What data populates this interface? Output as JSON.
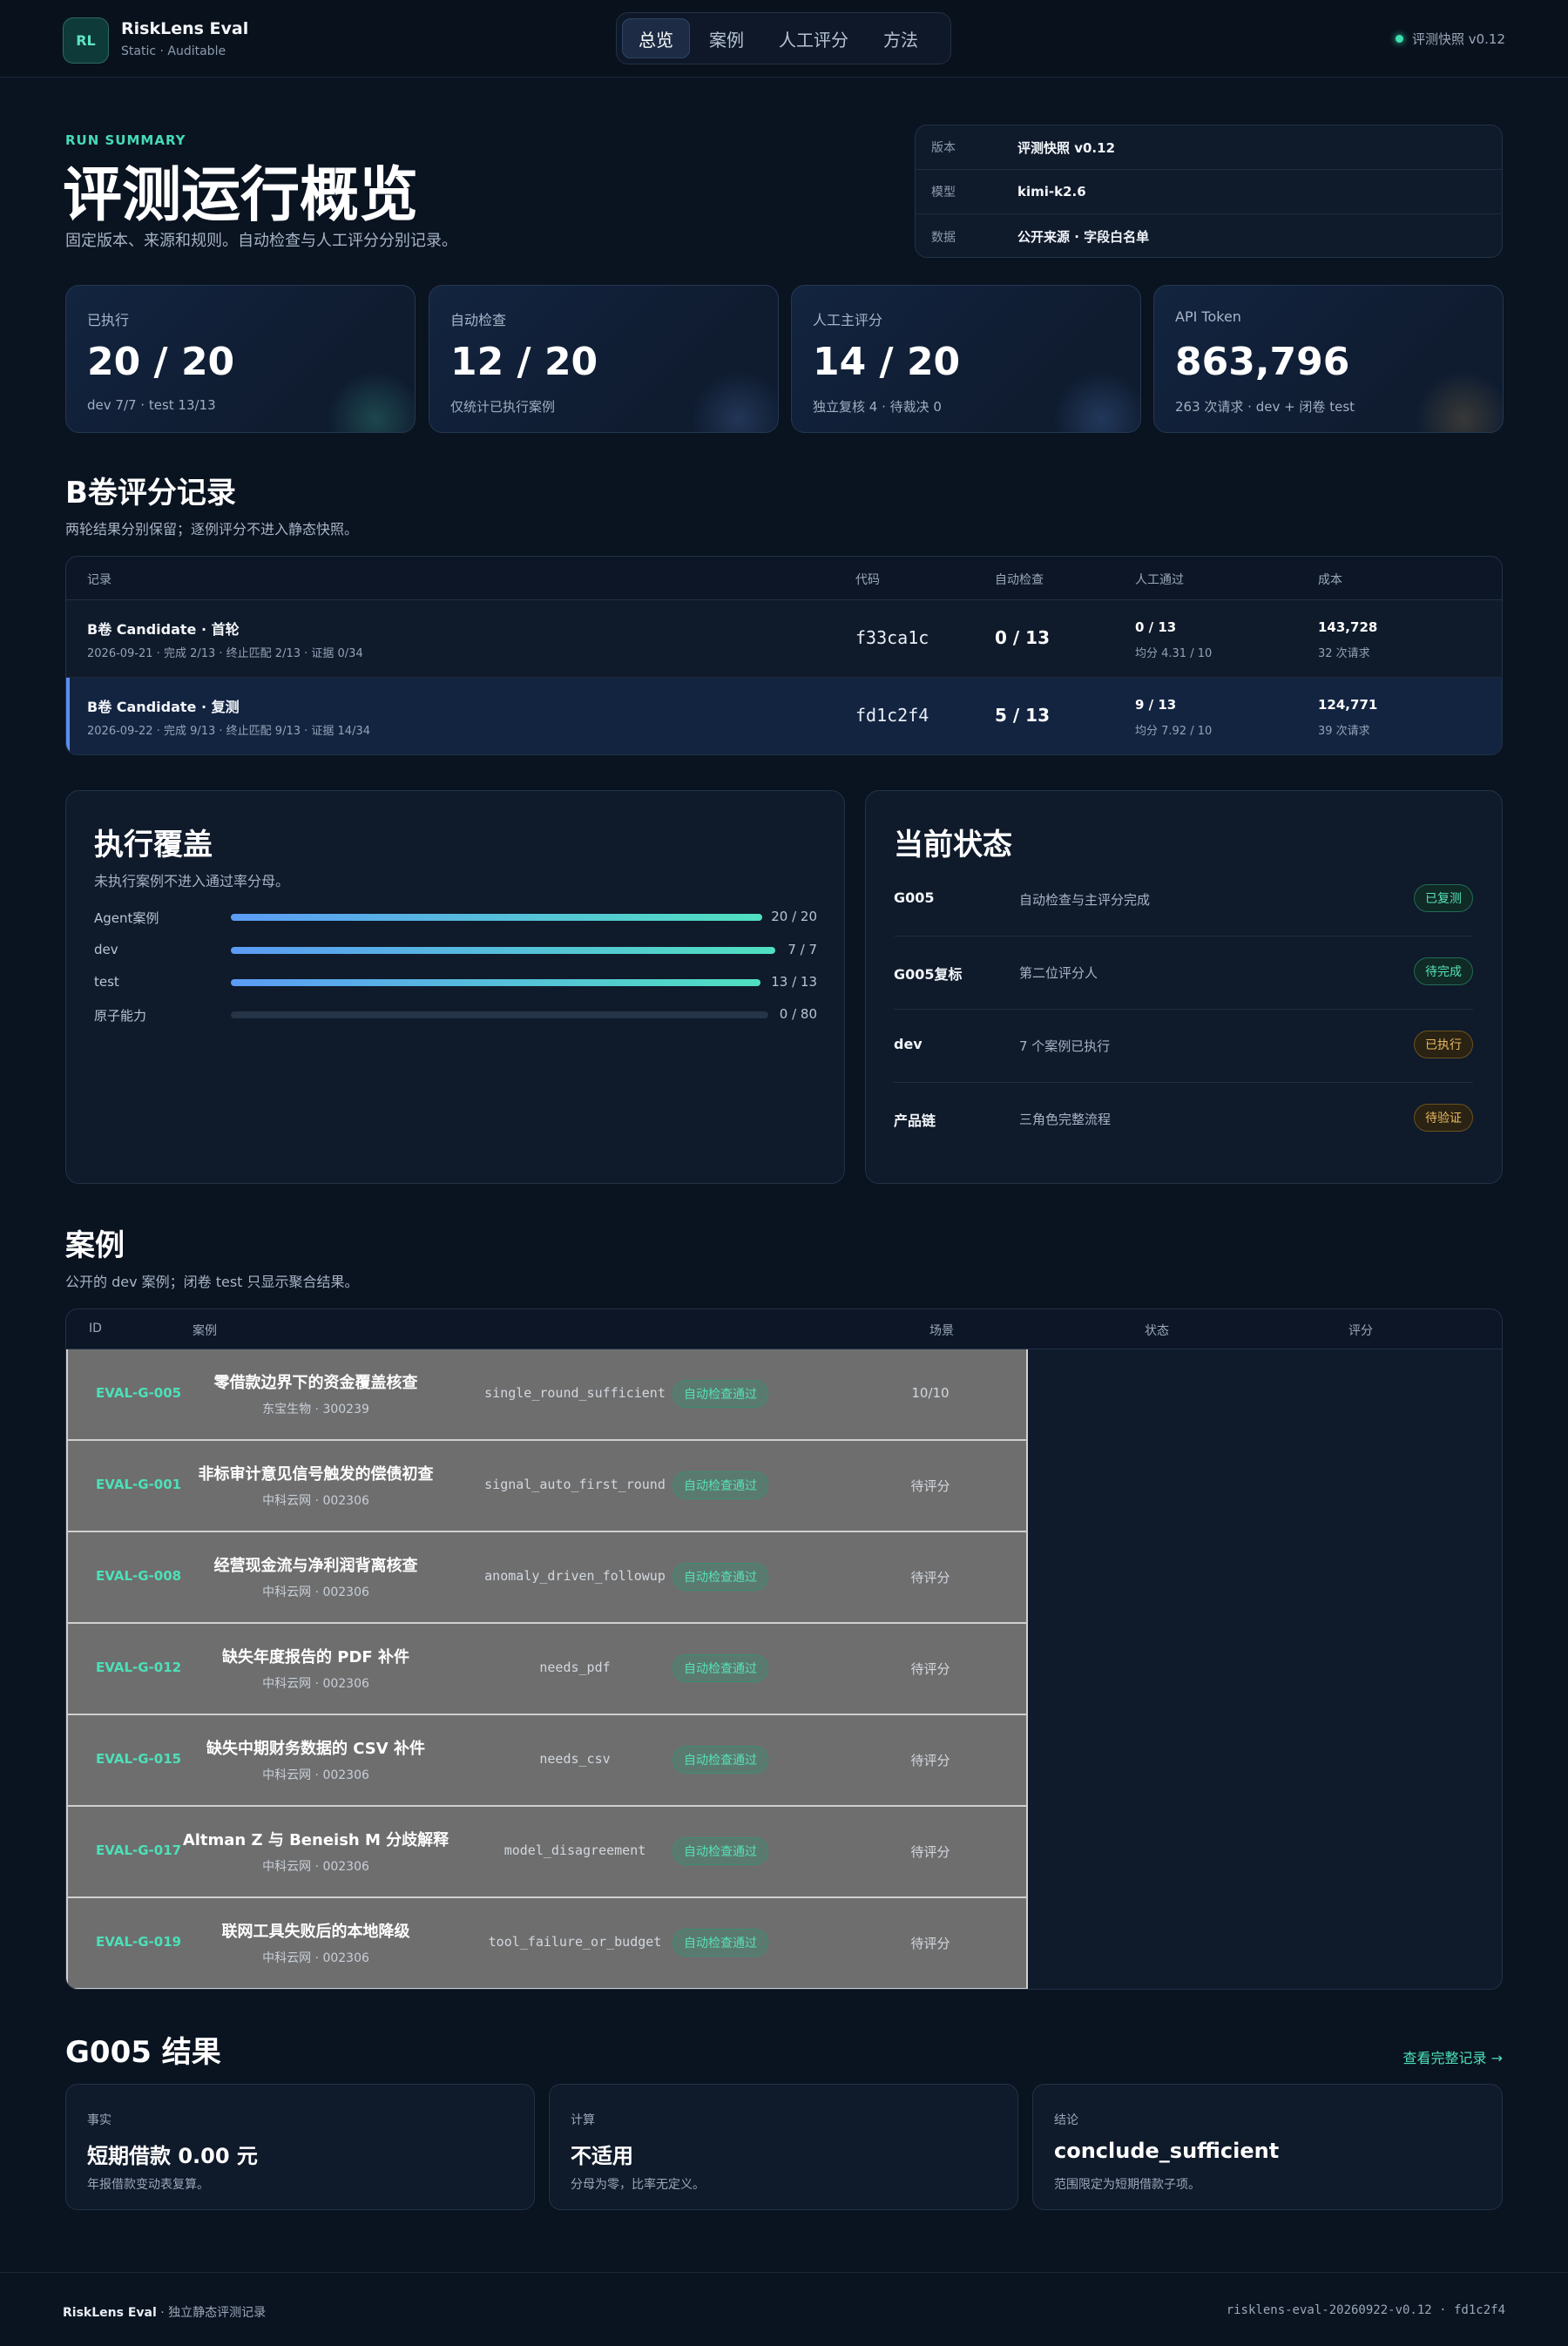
{
  "header": {
    "logo": "RL",
    "brand": "RiskLens Eval",
    "tagline": "Static · Auditable",
    "nav": [
      "总览",
      "案例",
      "人工评分",
      "方法"
    ],
    "snapshot": "评测快照 v0.12"
  },
  "hero": {
    "eyebrow": "RUN SUMMARY",
    "title": "评测运行概览",
    "subtitle": "固定版本、来源和规则。自动检查与人工评分分别记录。",
    "meta": [
      {
        "k": "版本",
        "v": "评测快照 v0.12"
      },
      {
        "k": "模型",
        "v": "kimi-k2.6"
      },
      {
        "k": "数据",
        "v": "公开来源 · 字段白名单"
      }
    ]
  },
  "stats": [
    {
      "label": "已执行",
      "value": "20 / 20",
      "note": "dev 7/7 · test 13/13"
    },
    {
      "label": "自动检查",
      "value": "12 / 20",
      "note": "仅统计已执行案例"
    },
    {
      "label": "人工主评分",
      "value": "14 / 20",
      "note": "独立复核 4 · 待裁决 0"
    },
    {
      "label": "API Token",
      "value": "863,796",
      "note": "263 次请求 · dev + 闭卷 test"
    }
  ],
  "b_section": {
    "title": "B卷评分记录",
    "subtitle": "两轮结果分别保留；逐例评分不进入静态快照。",
    "columns": [
      "记录",
      "代码",
      "自动检查",
      "人工通过",
      "成本"
    ],
    "rows": [
      {
        "title": "B卷 Candidate · 首轮",
        "meta": "2026-09-21 · 完成 2/13 · 终止匹配 2/13 · 证据 0/34",
        "code": "f33ca1c",
        "auto": "0 / 13",
        "manual": "0 / 13",
        "avg": "均分 4.31 / 10",
        "cost": "143,728",
        "req": "32 次请求"
      },
      {
        "title": "B卷 Candidate · 复测",
        "meta": "2026-09-22 · 完成 9/13 · 终止匹配 9/13 · 证据 14/34",
        "code": "fd1c2f4",
        "auto": "5 / 13",
        "manual": "9 / 13",
        "avg": "均分 7.92 / 10",
        "cost": "124,771",
        "req": "39 次请求"
      }
    ]
  },
  "coverage": {
    "title": "执行覆盖",
    "subtitle": "未执行案例不进入通过率分母。",
    "rows": [
      {
        "label": "Agent案例",
        "value": "20 / 20",
        "fraction": 1.0
      },
      {
        "label": "dev",
        "value": "7 / 7",
        "fraction": 1.0
      },
      {
        "label": "test",
        "value": "13 / 13",
        "fraction": 1.0
      },
      {
        "label": "原子能力",
        "value": "0 / 80",
        "fraction": 0.0
      }
    ]
  },
  "status": {
    "title": "当前状态",
    "rows": [
      {
        "k": "G005",
        "d": "自动检查与主评分完成",
        "badge": "已复测",
        "tone": "g"
      },
      {
        "k": "G005复标",
        "d": "第二位评分人",
        "badge": "待完成",
        "tone": "g"
      },
      {
        "k": "dev",
        "d": "7 个案例已执行",
        "badge": "已执行",
        "tone": "y"
      },
      {
        "k": "产品链",
        "d": "三角色完整流程",
        "badge": "待验证",
        "tone": "y"
      }
    ]
  },
  "cases": {
    "title": "案例",
    "subtitle": "公开的 dev 案例；闭卷 test 只显示聚合结果。",
    "columns": [
      "ID",
      "案例",
      "场景",
      "状态",
      "评分"
    ],
    "rows": [
      {
        "id": "EVAL-G-005",
        "title": "零借款边界下的资金覆盖核查",
        "company": "东宝生物 · 300239",
        "scene": "single_round_sufficient",
        "status": "自动检查通过",
        "score": "10/10"
      },
      {
        "id": "EVAL-G-001",
        "title": "非标审计意见信号触发的偿债初查",
        "company": "中科云网 · 002306",
        "scene": "signal_auto_first_round",
        "status": "自动检查通过",
        "score": "待评分"
      },
      {
        "id": "EVAL-G-008",
        "title": "经营现金流与净利润背离核查",
        "company": "中科云网 · 002306",
        "scene": "anomaly_driven_followup",
        "status": "自动检查通过",
        "score": "待评分"
      },
      {
        "id": "EVAL-G-012",
        "title": "缺失年度报告的 PDF 补件",
        "company": "中科云网 · 002306",
        "scene": "needs_pdf",
        "status": "自动检查通过",
        "score": "待评分"
      },
      {
        "id": "EVAL-G-015",
        "title": "缺失中期财务数据的 CSV 补件",
        "company": "中科云网 · 002306",
        "scene": "needs_csv",
        "status": "自动检查通过",
        "score": "待评分"
      },
      {
        "id": "EVAL-G-017",
        "title": "Altman Z 与 Beneish M 分歧解释",
        "company": "中科云网 · 002306",
        "scene": "model_disagreement",
        "status": "自动检查通过",
        "score": "待评分"
      },
      {
        "id": "EVAL-G-019",
        "title": "联网工具失败后的本地降级",
        "company": "中科云网 · 002306",
        "scene": "tool_failure_or_budget",
        "status": "自动检查通过",
        "score": "待评分"
      }
    ]
  },
  "results": {
    "title": "G005 结果",
    "link": "查看完整记录 →",
    "cards": [
      {
        "k": "事实",
        "v": "短期借款 0.00 元",
        "n": "年报借款变动表复算。"
      },
      {
        "k": "计算",
        "v": "不适用",
        "n": "分母为零，比率无定义。"
      },
      {
        "k": "结论",
        "v": "conclude_sufficient",
        "n": "范围限定为短期借款子项。"
      }
    ]
  },
  "footer": {
    "brand": "RiskLens Eval",
    "tail": " · 独立静态评测记录",
    "build": "risklens-eval-20260922-v0.12 · fd1c2f4"
  },
  "colors": {
    "accent": "#4de0b8",
    "background": "#0a1320",
    "panel": "#0f1a2b",
    "blue": "#5b9cf5"
  }
}
